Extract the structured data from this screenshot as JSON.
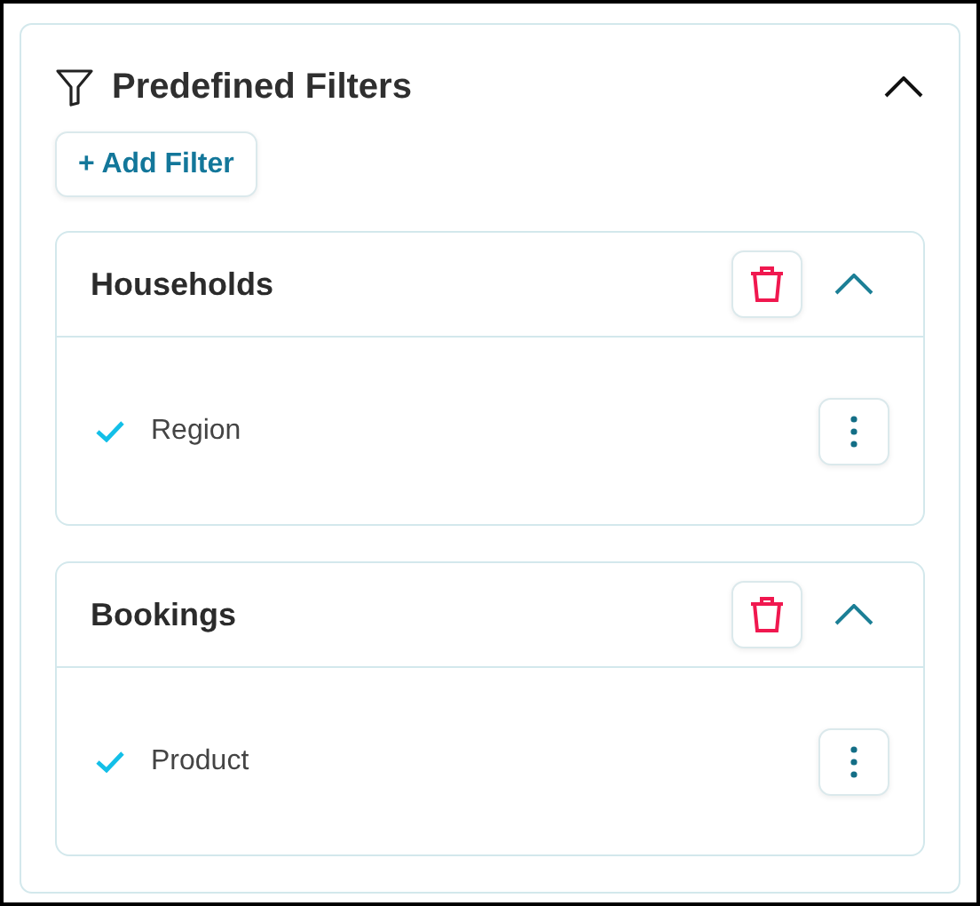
{
  "panel": {
    "title": "Predefined Filters",
    "expanded": true,
    "add_button": "+ Add Filter"
  },
  "groups": [
    {
      "title": "Households",
      "expanded": true,
      "filters": [
        {
          "label": "Region",
          "checked": true
        }
      ]
    },
    {
      "title": "Bookings",
      "expanded": true,
      "filters": [
        {
          "label": "Product",
          "checked": true
        }
      ]
    }
  ]
}
